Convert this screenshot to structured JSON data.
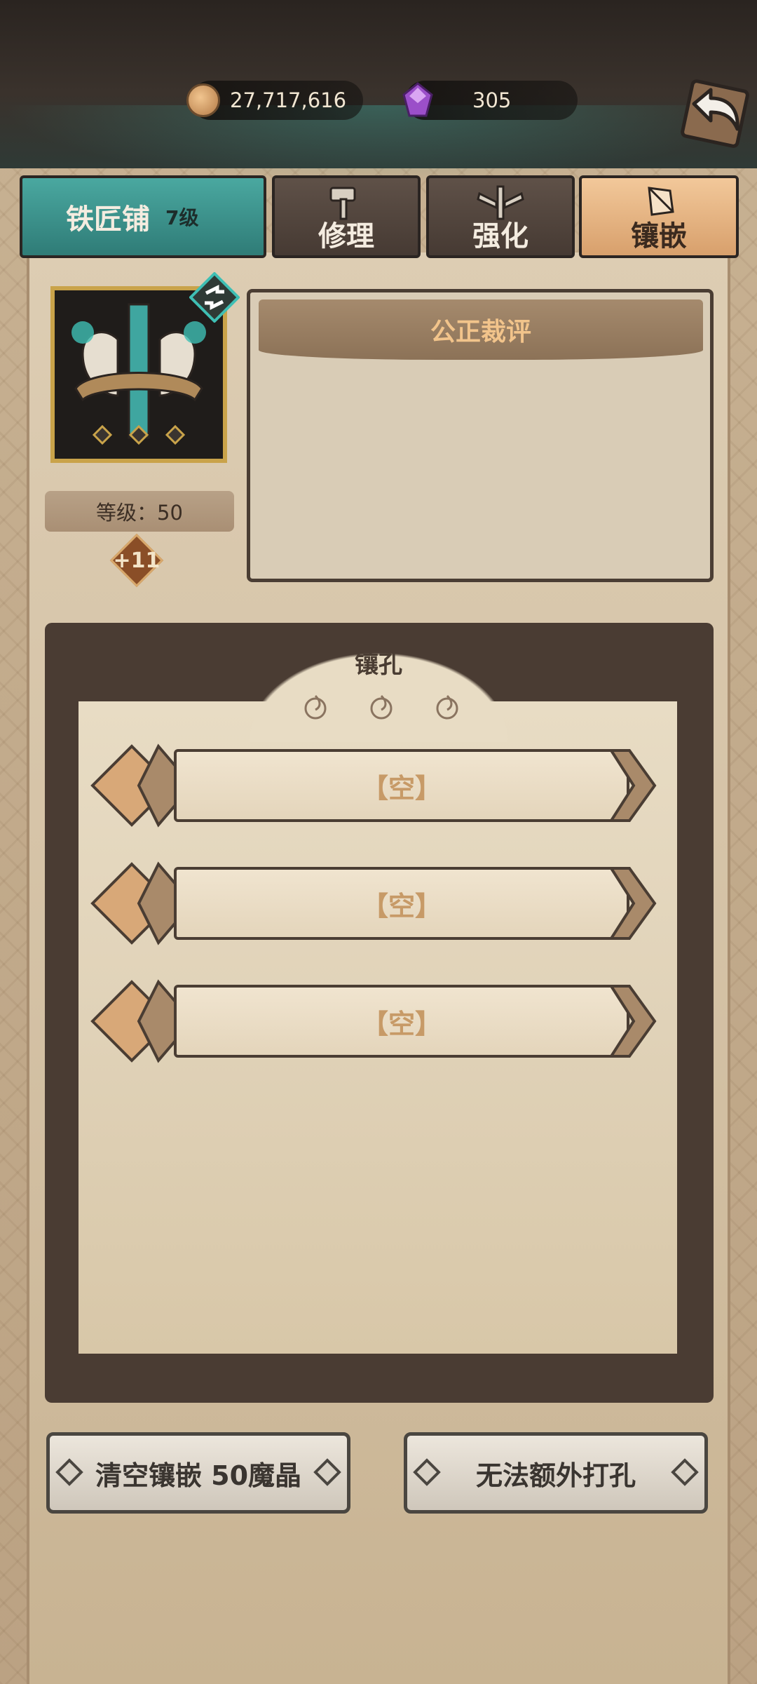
{
  "currencies": {
    "gold": {
      "value": "27,717,616",
      "icon": "gold-coin-icon"
    },
    "gem": {
      "value": "305",
      "icon": "magic-crystal-icon"
    }
  },
  "tabs": {
    "smith": {
      "label": "铁匠铺",
      "level": "7级"
    },
    "repair": {
      "label": "修理"
    },
    "strengthen": {
      "label": "强化"
    },
    "inlay": {
      "label": "镶嵌"
    }
  },
  "item": {
    "level_text": "等级：50",
    "enhance": "+11",
    "name": "公正裁评"
  },
  "sockets": {
    "title": "镶孔",
    "slots": [
      {
        "label": "【空】"
      },
      {
        "label": "【空】"
      },
      {
        "label": "【空】"
      }
    ]
  },
  "buttons": {
    "clear": "清空镶嵌 50魔晶",
    "hole": "无法额外打孔"
  },
  "colors": {
    "teal_tab": "#3f948d",
    "active_tab": "#e8b684",
    "name_gold": "#f2c48b",
    "empty_slot_text": "#c79a67"
  }
}
